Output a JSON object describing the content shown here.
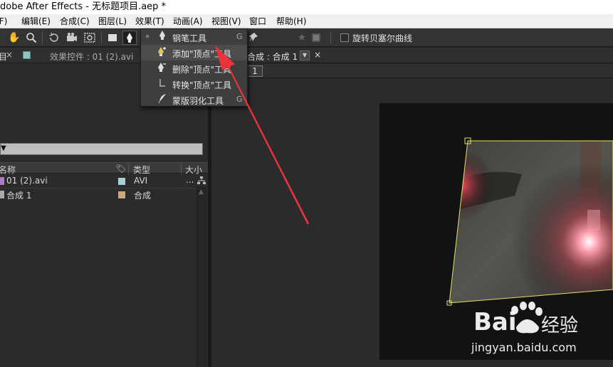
{
  "window": {
    "title": "dobe After Effects - 无标题项目.aep *"
  },
  "menubar": {
    "items": [
      "(F)",
      "编辑(E)",
      "合成(C)",
      "图层(L)",
      "效果(T)",
      "动画(A)",
      "视图(V)",
      "窗口",
      "帮助(H)"
    ]
  },
  "toolbar": {
    "bezier_label": "旋转贝塞尔曲线",
    "icons": [
      "hand-icon",
      "zoom-icon",
      "rotate-icon",
      "camera-icon",
      "pan-behind-icon",
      "rectangle-icon",
      "pen-icon",
      "pin-icon",
      "star-icon",
      "mask-icon"
    ]
  },
  "pen_menu": {
    "items": [
      {
        "label": "钢笔工具",
        "shortcut": "G",
        "icon": "pen-icon",
        "active": true
      },
      {
        "label": "添加\"顶点\"工具",
        "shortcut": "",
        "icon": "add-vertex-icon",
        "hover": true
      },
      {
        "label": "删除\"顶点\"工具",
        "shortcut": "",
        "icon": "delete-vertex-icon"
      },
      {
        "label": "转换\"顶点\"工具",
        "shortcut": "",
        "icon": "convert-vertex-icon"
      },
      {
        "label": "蒙版羽化工具",
        "shortcut": "G",
        "icon": "feather-icon"
      }
    ]
  },
  "left_panel": {
    "tab_close": "×",
    "tab_project": "目",
    "tab_effects": "效果控件 : 01 (2).avi",
    "columns": {
      "name": "名称",
      "type": "类型",
      "size": "大小"
    },
    "items": [
      {
        "name": "01 (2).avi",
        "type": "AVI",
        "extra": "...",
        "swatch": "#a8d0d8",
        "icon_color": "#b07cc0"
      },
      {
        "name": "合成 1",
        "type": "合成",
        "extra": "",
        "swatch": "#c8a880",
        "icon_color": "#aaaaaa"
      }
    ]
  },
  "right_panel": {
    "comp_tab": "合成 : 合成 1",
    "comp_close": "×",
    "sub_tab_value": "1"
  },
  "watermark": {
    "brand_left": "Bai",
    "brand_right": "经验",
    "url": "jingyan.baidu.com"
  },
  "colors": {
    "accent_yellow": "#e6e06a",
    "arrow_red": "#e8333a",
    "panel_bg": "#2b2b2b"
  }
}
